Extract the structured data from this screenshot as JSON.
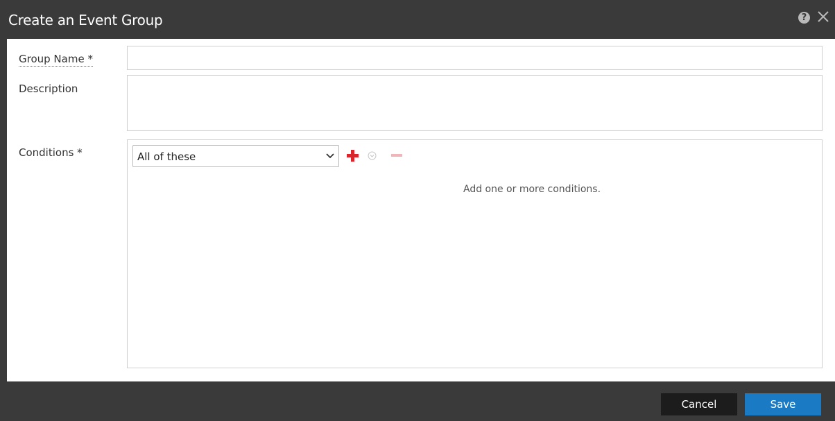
{
  "dialog": {
    "title": "Create an Event Group",
    "help_icon": "help-icon",
    "help_glyph": "?",
    "close_icon": "close-icon"
  },
  "form": {
    "group_name_label": "Group Name *",
    "group_name_value": "",
    "description_label": "Description",
    "description_value": "",
    "conditions_label": "Conditions *"
  },
  "conditions": {
    "match_select_value": "All of these",
    "add_icon": "add-icon",
    "expand_icon": "chevron-down-circle-icon",
    "remove_icon": "remove-icon",
    "empty_hint": "Add one or more conditions."
  },
  "footer": {
    "cancel_label": "Cancel",
    "save_label": "Save"
  },
  "colors": {
    "titlebar": "#3a3a3a",
    "primary_button": "#1a7bc4",
    "secondary_button": "#1c1c1c",
    "add_icon": "#d9262c",
    "remove_icon_disabled": "#f0b5b8"
  }
}
